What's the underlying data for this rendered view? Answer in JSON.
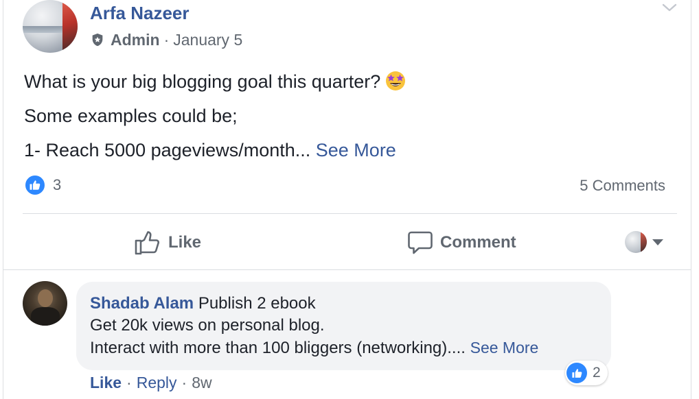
{
  "post": {
    "author": "Arfa Nazeer",
    "role": "Admin",
    "separator": "·",
    "date": "January 5",
    "lines": [
      "What is your big blogging goal this quarter?",
      "Some examples could be;",
      "1- Reach 5000 pageviews/month..."
    ],
    "see_more": "See More",
    "reaction_count": "3",
    "comments_count": "5 Comments"
  },
  "actions": {
    "like_label": "Like",
    "comment_label": "Comment"
  },
  "comment": {
    "author": "Shadab Alam",
    "lines": [
      "Publish 2 ebook",
      "Get 20k views on personal blog.",
      "Interact with more than 100 bliggers (networking)...."
    ],
    "see_more": "See More",
    "reaction_count": "2",
    "like_label": "Like",
    "reply_label": "Reply",
    "separator": "·",
    "time": "8w"
  },
  "icons": {
    "role": "admin-shield-icon",
    "menu": "chevron-down-icon",
    "emoji": "star-struck-emoji",
    "reaction": "like-reaction-icon",
    "like_action": "thumbs-up-outline-icon",
    "comment_action": "speech-bubble-icon",
    "audience": "caret-down-icon"
  },
  "colors": {
    "link_blue": "#365899",
    "like_blue": "#2d88ff",
    "secondary_text": "#606770",
    "bubble_bg": "#f2f3f5"
  }
}
